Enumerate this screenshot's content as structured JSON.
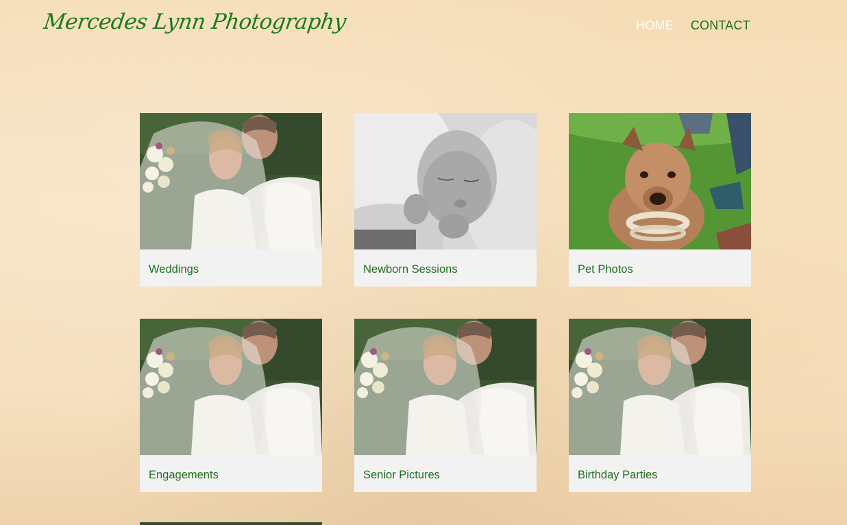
{
  "site": {
    "title": "Mercedes Lynn Photography"
  },
  "nav": {
    "items": [
      {
        "label": "HOME",
        "active": true
      },
      {
        "label": "CONTACT",
        "active": false
      }
    ]
  },
  "colors": {
    "brand_green": "#1c7a1c",
    "caption_green": "#236e23",
    "nav_active": "#ffffff",
    "card_bg": "#f2f2f2"
  },
  "galleries": [
    {
      "label": "Weddings",
      "image": "wedding-photo"
    },
    {
      "label": "Newborn Sessions",
      "image": "newborn-photo"
    },
    {
      "label": "Pet Photos",
      "image": "dog-photo"
    },
    {
      "label": "Engagements",
      "image": "wedding-photo"
    },
    {
      "label": "Senior Pictures",
      "image": "wedding-photo"
    },
    {
      "label": "Birthday Parties",
      "image": "wedding-photo"
    }
  ]
}
